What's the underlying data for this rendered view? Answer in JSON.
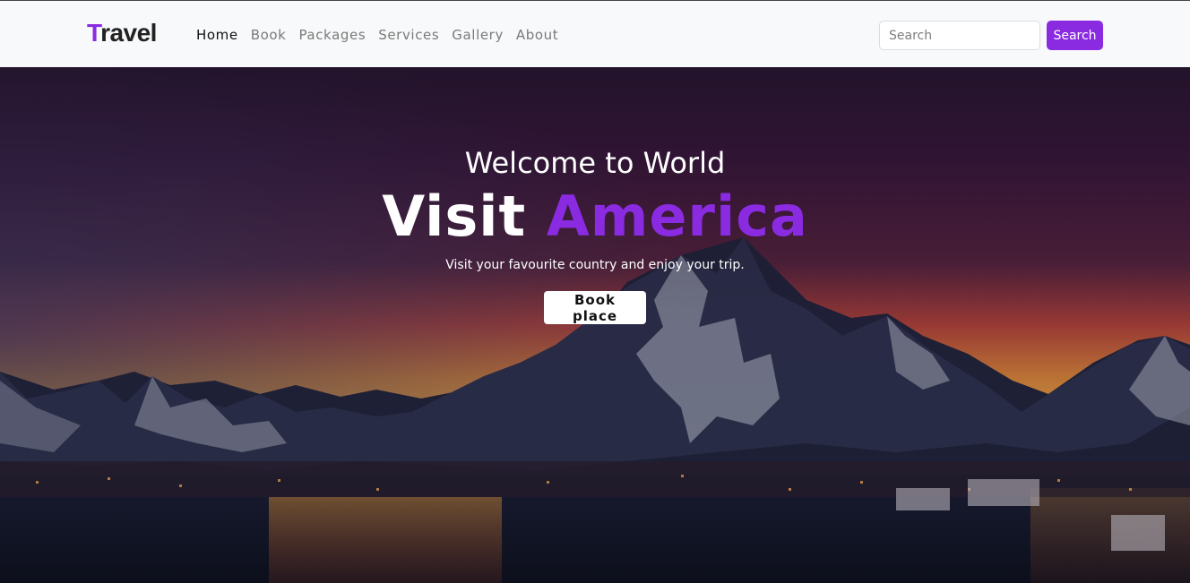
{
  "navbar": {
    "brand_first": "T",
    "brand_rest": "ravel",
    "links": [
      {
        "label": "Home",
        "active": true
      },
      {
        "label": "Book"
      },
      {
        "label": "Packages"
      },
      {
        "label": "Services"
      },
      {
        "label": "Gallery"
      },
      {
        "label": "About"
      }
    ],
    "search": {
      "placeholder": "Search",
      "value": ""
    },
    "search_button": "Search"
  },
  "hero": {
    "welcome": "Welcome to World",
    "headline_1": "Visit ",
    "headline_2": "America",
    "tagline": "Visit your favourite country and enjoy your trip.",
    "cta": "Book place"
  },
  "colors": {
    "accent": "#8a2be2",
    "nav_bg": "#f8f9fa"
  }
}
